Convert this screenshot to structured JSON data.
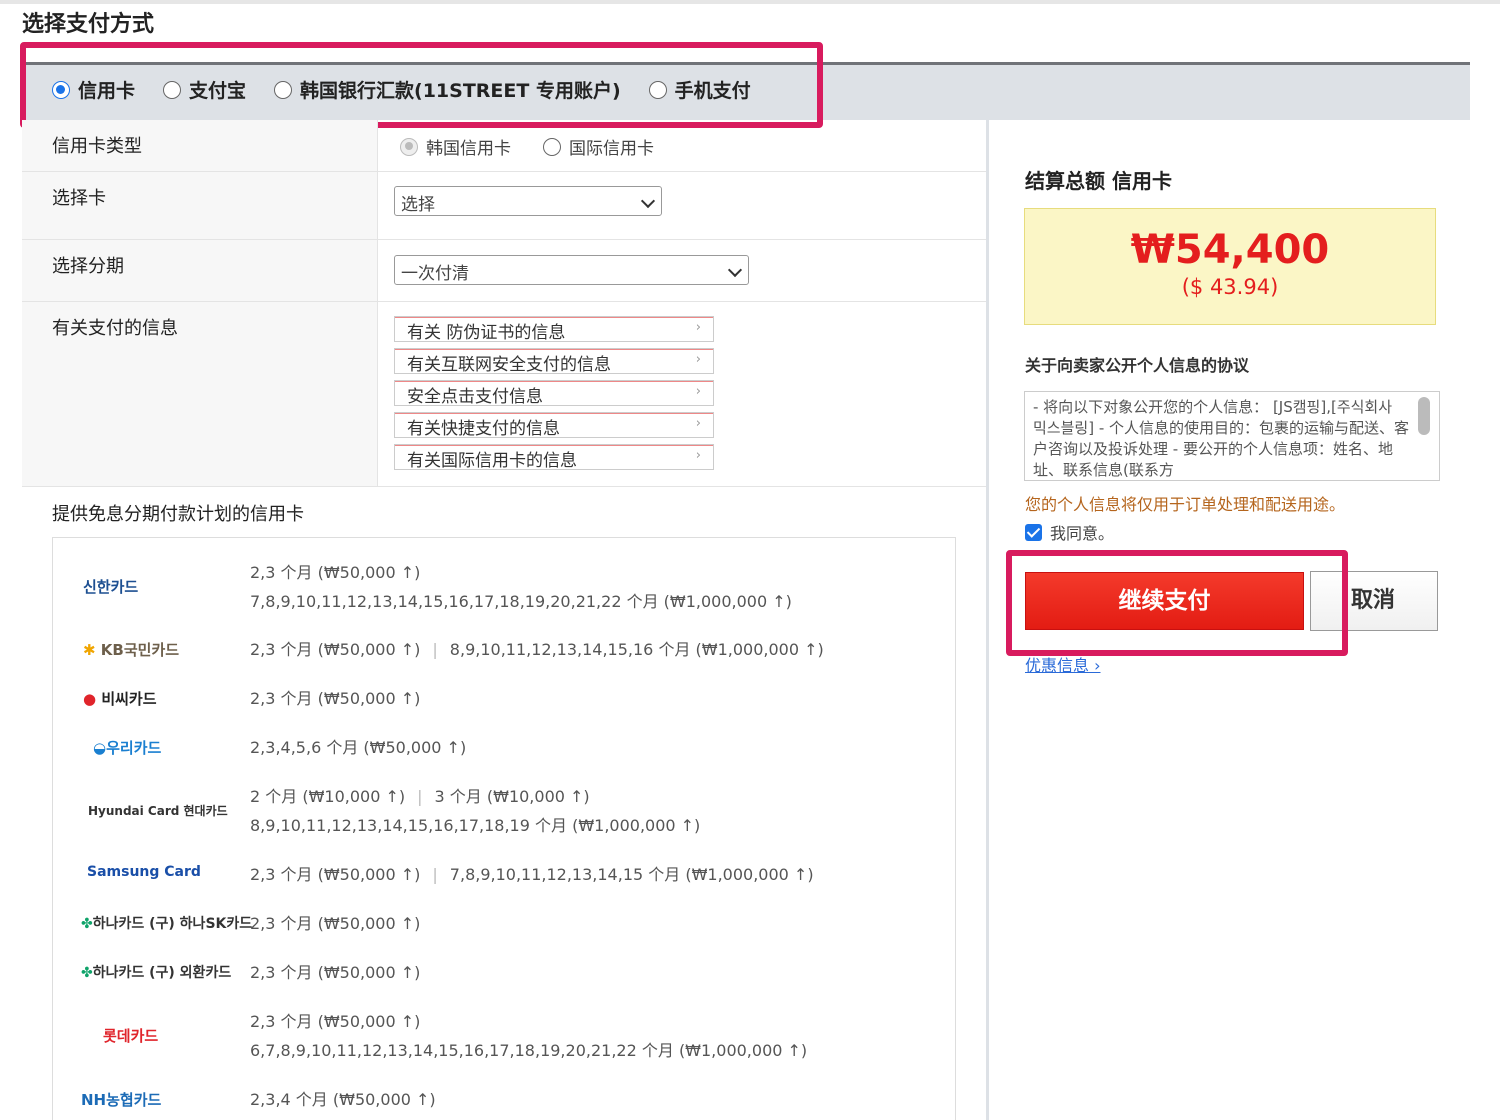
{
  "page_title": "选择支付方式",
  "methods": [
    {
      "label": "信用卡",
      "checked": true
    },
    {
      "label": "支付宝",
      "checked": false
    },
    {
      "label": "韩国银行汇款(11STREET 专用账户)",
      "checked": false
    },
    {
      "label": "手机支付",
      "checked": false
    }
  ],
  "form": {
    "card_type_label": "信用卡类型",
    "card_type_opts": [
      "韩国信用卡",
      "国际信用卡"
    ],
    "select_card_label": "选择卡",
    "select_card_value": "选择",
    "installment_label": "选择分期",
    "installment_value": "一次付清",
    "payment_info_label": "有关支付的信息",
    "info_links": [
      "有关 防伪证书的信息",
      "有关互联网安全支付的信息",
      "安全点击支付信息",
      "有关快捷支付的信息",
      "有关国际信用卡的信息"
    ]
  },
  "installment": {
    "title": "提供免息分期付款计划的信用卡",
    "banks": [
      {
        "logo": "신한카드",
        "color": "#1d4f91",
        "plans": [
          "2,3 个月 (₩50,000 ↑)",
          "7,8,9,10,11,12,13,14,15,16,17,18,19,20,21,22 个月 (₩1,000,000 ↑)"
        ]
      },
      {
        "logo": "KB국민카드",
        "color": "#6d5f4b",
        "plans": [
          "2,3 个月 (₩50,000 ↑)",
          "8,9,10,11,12,13,14,15,16 个月 (₩1,000,000 ↑)"
        ],
        "inline": true
      },
      {
        "logo": "비씨카드",
        "color": "#222222",
        "plans": [
          "2,3 个月 (₩50,000 ↑)"
        ]
      },
      {
        "logo": "우리카드",
        "color": "#1a7fd0",
        "plans": [
          "2,3,4,5,6 个月 (₩50,000 ↑)"
        ]
      },
      {
        "logo": "Hyundai Card 현대카드",
        "color": "#333333",
        "plans": [
          "2 个月 (₩10,000 ↑)",
          "3 个月 (₩10,000 ↑)",
          "8,9,10,11,12,13,14,15,16,17,18,19 个月 (₩1,000,000 ↑)"
        ],
        "mixed": true
      },
      {
        "logo": "Samsung Card",
        "color": "#1a4fa8",
        "plans": [
          "2,3 个月 (₩50,000 ↑)",
          "7,8,9,10,11,12,13,14,15 个月 (₩1,000,000 ↑)"
        ],
        "inline": true
      },
      {
        "logo": "하나카드 (구) 하나SK카드",
        "color": "#333333",
        "plans": [
          "2,3 个月 (₩50,000 ↑)"
        ]
      },
      {
        "logo": "하나카드 (구) 외환카드",
        "color": "#333333",
        "plans": [
          "2,3 个月 (₩50,000 ↑)"
        ]
      },
      {
        "logo": "롯데카드",
        "color": "#e0242b",
        "plans": [
          "2,3 个月 (₩50,000 ↑)",
          "6,7,8,9,10,11,12,13,14,15,16,17,18,19,20,21,22 个月 (₩1,000,000 ↑)"
        ]
      },
      {
        "logo": "NH농협카드",
        "color": "#1c6bb6",
        "plans": [
          "2,3,4 个月 (₩50,000 ↑)"
        ]
      }
    ]
  },
  "summary": {
    "title": "结算总额 信用卡",
    "amount": "₩54,400",
    "amount_usd": "($ 43.94)",
    "agreement_title": "关于向卖家公开个人信息的协议",
    "agreement_text": "- 将向以下对象公开您的个人信息： [JS캠핑],[주식회사 믹스블링] - 个人信息的使用目的：包裹的运输与配送、客户咨询以及投诉处理 - 要公开的个人信息项：姓名、地址、联系信息(联系方",
    "notice": "您的个人信息将仅用于订单处理和配送用途。",
    "agree_label": "我同意。",
    "pay_button": "继续支付",
    "cancel_button": "取消",
    "promo_link": "优惠信息",
    "accent_color": "#e41e1e",
    "highlight_color": "#d81b5e"
  }
}
